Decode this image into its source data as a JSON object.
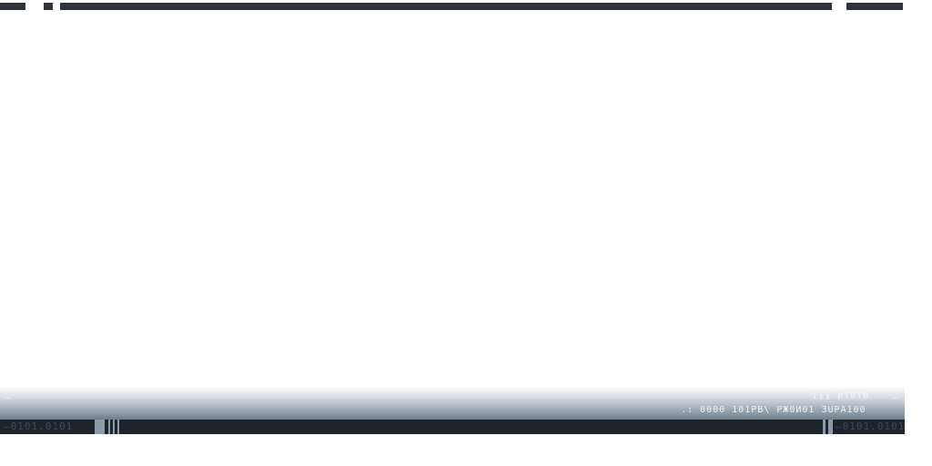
{
  "panel": {
    "dash_left": "–",
    "dash_right": "–",
    "line1": "111   ИТ0Т0",
    "line2": ".: 0000   101РВ\\   РЖ0И01  ЗUРА100"
  },
  "status_bar": {
    "code_left": "—0101.0101",
    "code_right": "—0101.0101"
  },
  "colors": {
    "top_bar": "#303339",
    "status_bar": "#1d242c",
    "marker": "#8d9aa7"
  }
}
